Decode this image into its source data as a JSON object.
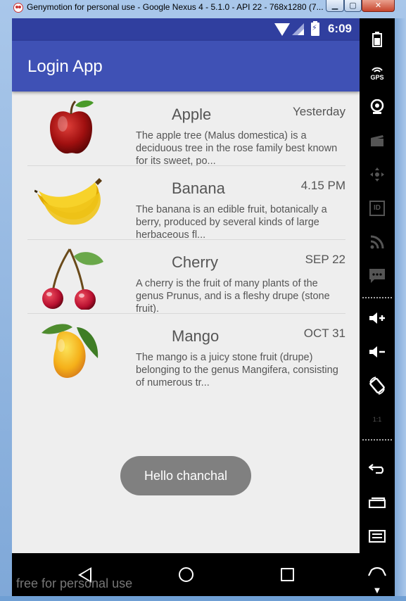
{
  "window": {
    "title": "Genymotion for personal use - Google Nexus 4 - 5.1.0 - API 22 - 768x1280 (7...",
    "minimize_glyph": "▁",
    "maximize_glyph": "▢",
    "close_glyph": "✕"
  },
  "statusbar": {
    "time": "6:09",
    "icons": [
      "wifi-icon",
      "signal-icon",
      "battery-charging-icon"
    ]
  },
  "toolbar": {
    "title": "Login App"
  },
  "fruits": [
    {
      "name": "Apple",
      "time": "Yesterday",
      "description": "The apple tree (Malus domestica) is a deciduous tree in the rose family best known for its sweet, po...",
      "icon": "apple-image"
    },
    {
      "name": "Banana",
      "time": "4.15 PM",
      "description": "The banana is an edible fruit, botanically a berry, produced by several kinds of large herbaceous fl...",
      "icon": "banana-image"
    },
    {
      "name": "Cherry",
      "time": "SEP 22",
      "description": "A cherry is the fruit of many plants of the genus Prunus, and is a fleshy drupe (stone fruit).",
      "icon": "cherry-image"
    },
    {
      "name": "Mango",
      "time": "OCT 31",
      "description": "The mango is a juicy stone fruit (drupe) belonging to the genus Mangifera, consisting of numerous tr...",
      "icon": "mango-image"
    }
  ],
  "toast": {
    "text": "Hello  chanchal"
  },
  "navbar": {
    "buttons": [
      "back-icon",
      "home-icon",
      "recents-icon"
    ],
    "watermark": "free for personal use"
  },
  "sidebar": {
    "gps_label": "GPS",
    "id_label": "ID",
    "rotate_label": "1:1",
    "icons": [
      "battery-icon",
      "gps-icon",
      "camera-icon",
      "video-icon",
      "dpad-icon",
      "id-icon",
      "rss-icon",
      "sms-icon",
      "volume-up-icon",
      "volume-down-icon",
      "rotate-icon",
      "pixel-perfect-icon",
      "back-icon",
      "recents-icon",
      "menu-icon",
      "home-icon"
    ]
  },
  "colors": {
    "statusbar": "#303f9f",
    "toolbar": "#3f51b5",
    "background": "#eeeeee",
    "toast": "#808080"
  }
}
